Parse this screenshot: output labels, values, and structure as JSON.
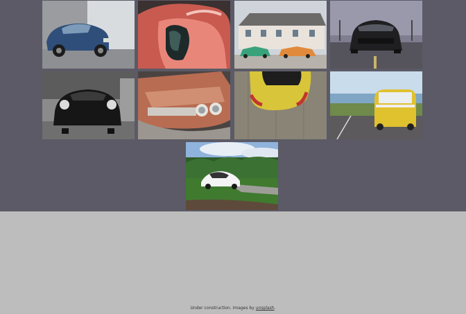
{
  "gallery": {
    "photos": [
      {
        "alt": "blue bentley coupe"
      },
      {
        "alt": "red ferrari close up"
      },
      {
        "alt": "vintage cars in front of house"
      },
      {
        "alt": "black ford mustang"
      },
      {
        "alt": "black vintage porsche"
      },
      {
        "alt": "rusty classic car"
      },
      {
        "alt": "yellow sports car from above"
      },
      {
        "alt": "yellow volkswagen van"
      },
      {
        "alt": "white tesla on grass"
      }
    ]
  },
  "footer": {
    "text": "Under construction. Images by",
    "link_label": "unsplash",
    "period": "."
  }
}
